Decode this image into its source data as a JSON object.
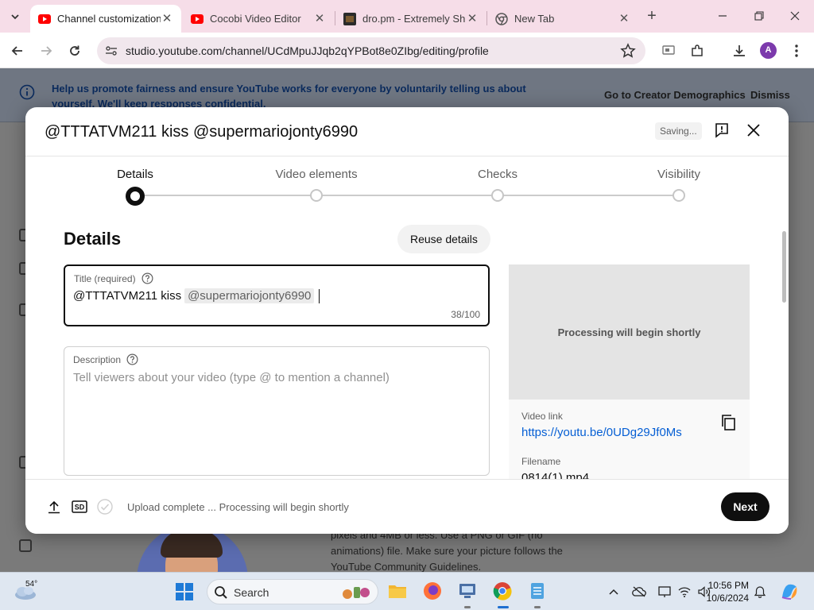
{
  "browser": {
    "tabs": [
      {
        "title": "Channel customization",
        "active": true,
        "favicon": "youtube-studio-icon"
      },
      {
        "title": "Cocobi Video Editor",
        "active": false,
        "favicon": "youtube-icon"
      },
      {
        "title": "dro.pm - Extremely Sh",
        "active": false,
        "favicon": "dropm-icon"
      },
      {
        "title": "New Tab",
        "active": false,
        "favicon": "chrome-icon"
      }
    ],
    "url": "studio.youtube.com/channel/UCdMpuJJqb2qYPBot8e0ZIbg/editing/profile",
    "profile_initial": "A"
  },
  "underlying_page": {
    "banner_text": "Help us promote fairness and ensure YouTube works for everyone by voluntarily telling us about yourself. We'll keep responses confidential.",
    "banner_primary": "Go to Creator Demographics",
    "banner_dismiss": "Dismiss",
    "body_snippet": "pixels and 4MB or less. Use a PNG or GIF (no animations) file. Make sure your picture follows the YouTube Community Guidelines."
  },
  "modal": {
    "title": "@TTTATVM211 kiss @supermariojonty6990",
    "saving": "Saving...",
    "steps": [
      {
        "label": "Details",
        "active": true
      },
      {
        "label": "Video elements",
        "active": false
      },
      {
        "label": "Checks",
        "active": false
      },
      {
        "label": "Visibility",
        "active": false
      }
    ],
    "section_title": "Details",
    "reuse_button": "Reuse details",
    "title_field": {
      "label": "Title (required)",
      "text": "@TTTATVM211 kiss",
      "mention": "@supermariojonty6990",
      "counter": "38/100"
    },
    "description_field": {
      "label": "Description",
      "placeholder": "Tell viewers about your video (type @ to mention a channel)"
    },
    "preview": {
      "processing": "Processing will begin shortly",
      "video_link_label": "Video link",
      "video_link": "https://youtu.be/0UDg29Jf0Ms",
      "filename_label": "Filename",
      "filename": "0814(1).mp4"
    },
    "footer": {
      "quality_badge": "SD",
      "status": "Upload complete ... Processing will begin shortly",
      "next_button": "Next"
    }
  },
  "taskbar": {
    "temperature": "54°",
    "search_label": "Search",
    "time": "10:56 PM",
    "date": "10/6/2024"
  },
  "colors": {
    "accent_link": "#065fd4",
    "next_button": "#0f0f0f",
    "tab_strip": "#f6dde8",
    "youtube_red": "#ff0000"
  }
}
